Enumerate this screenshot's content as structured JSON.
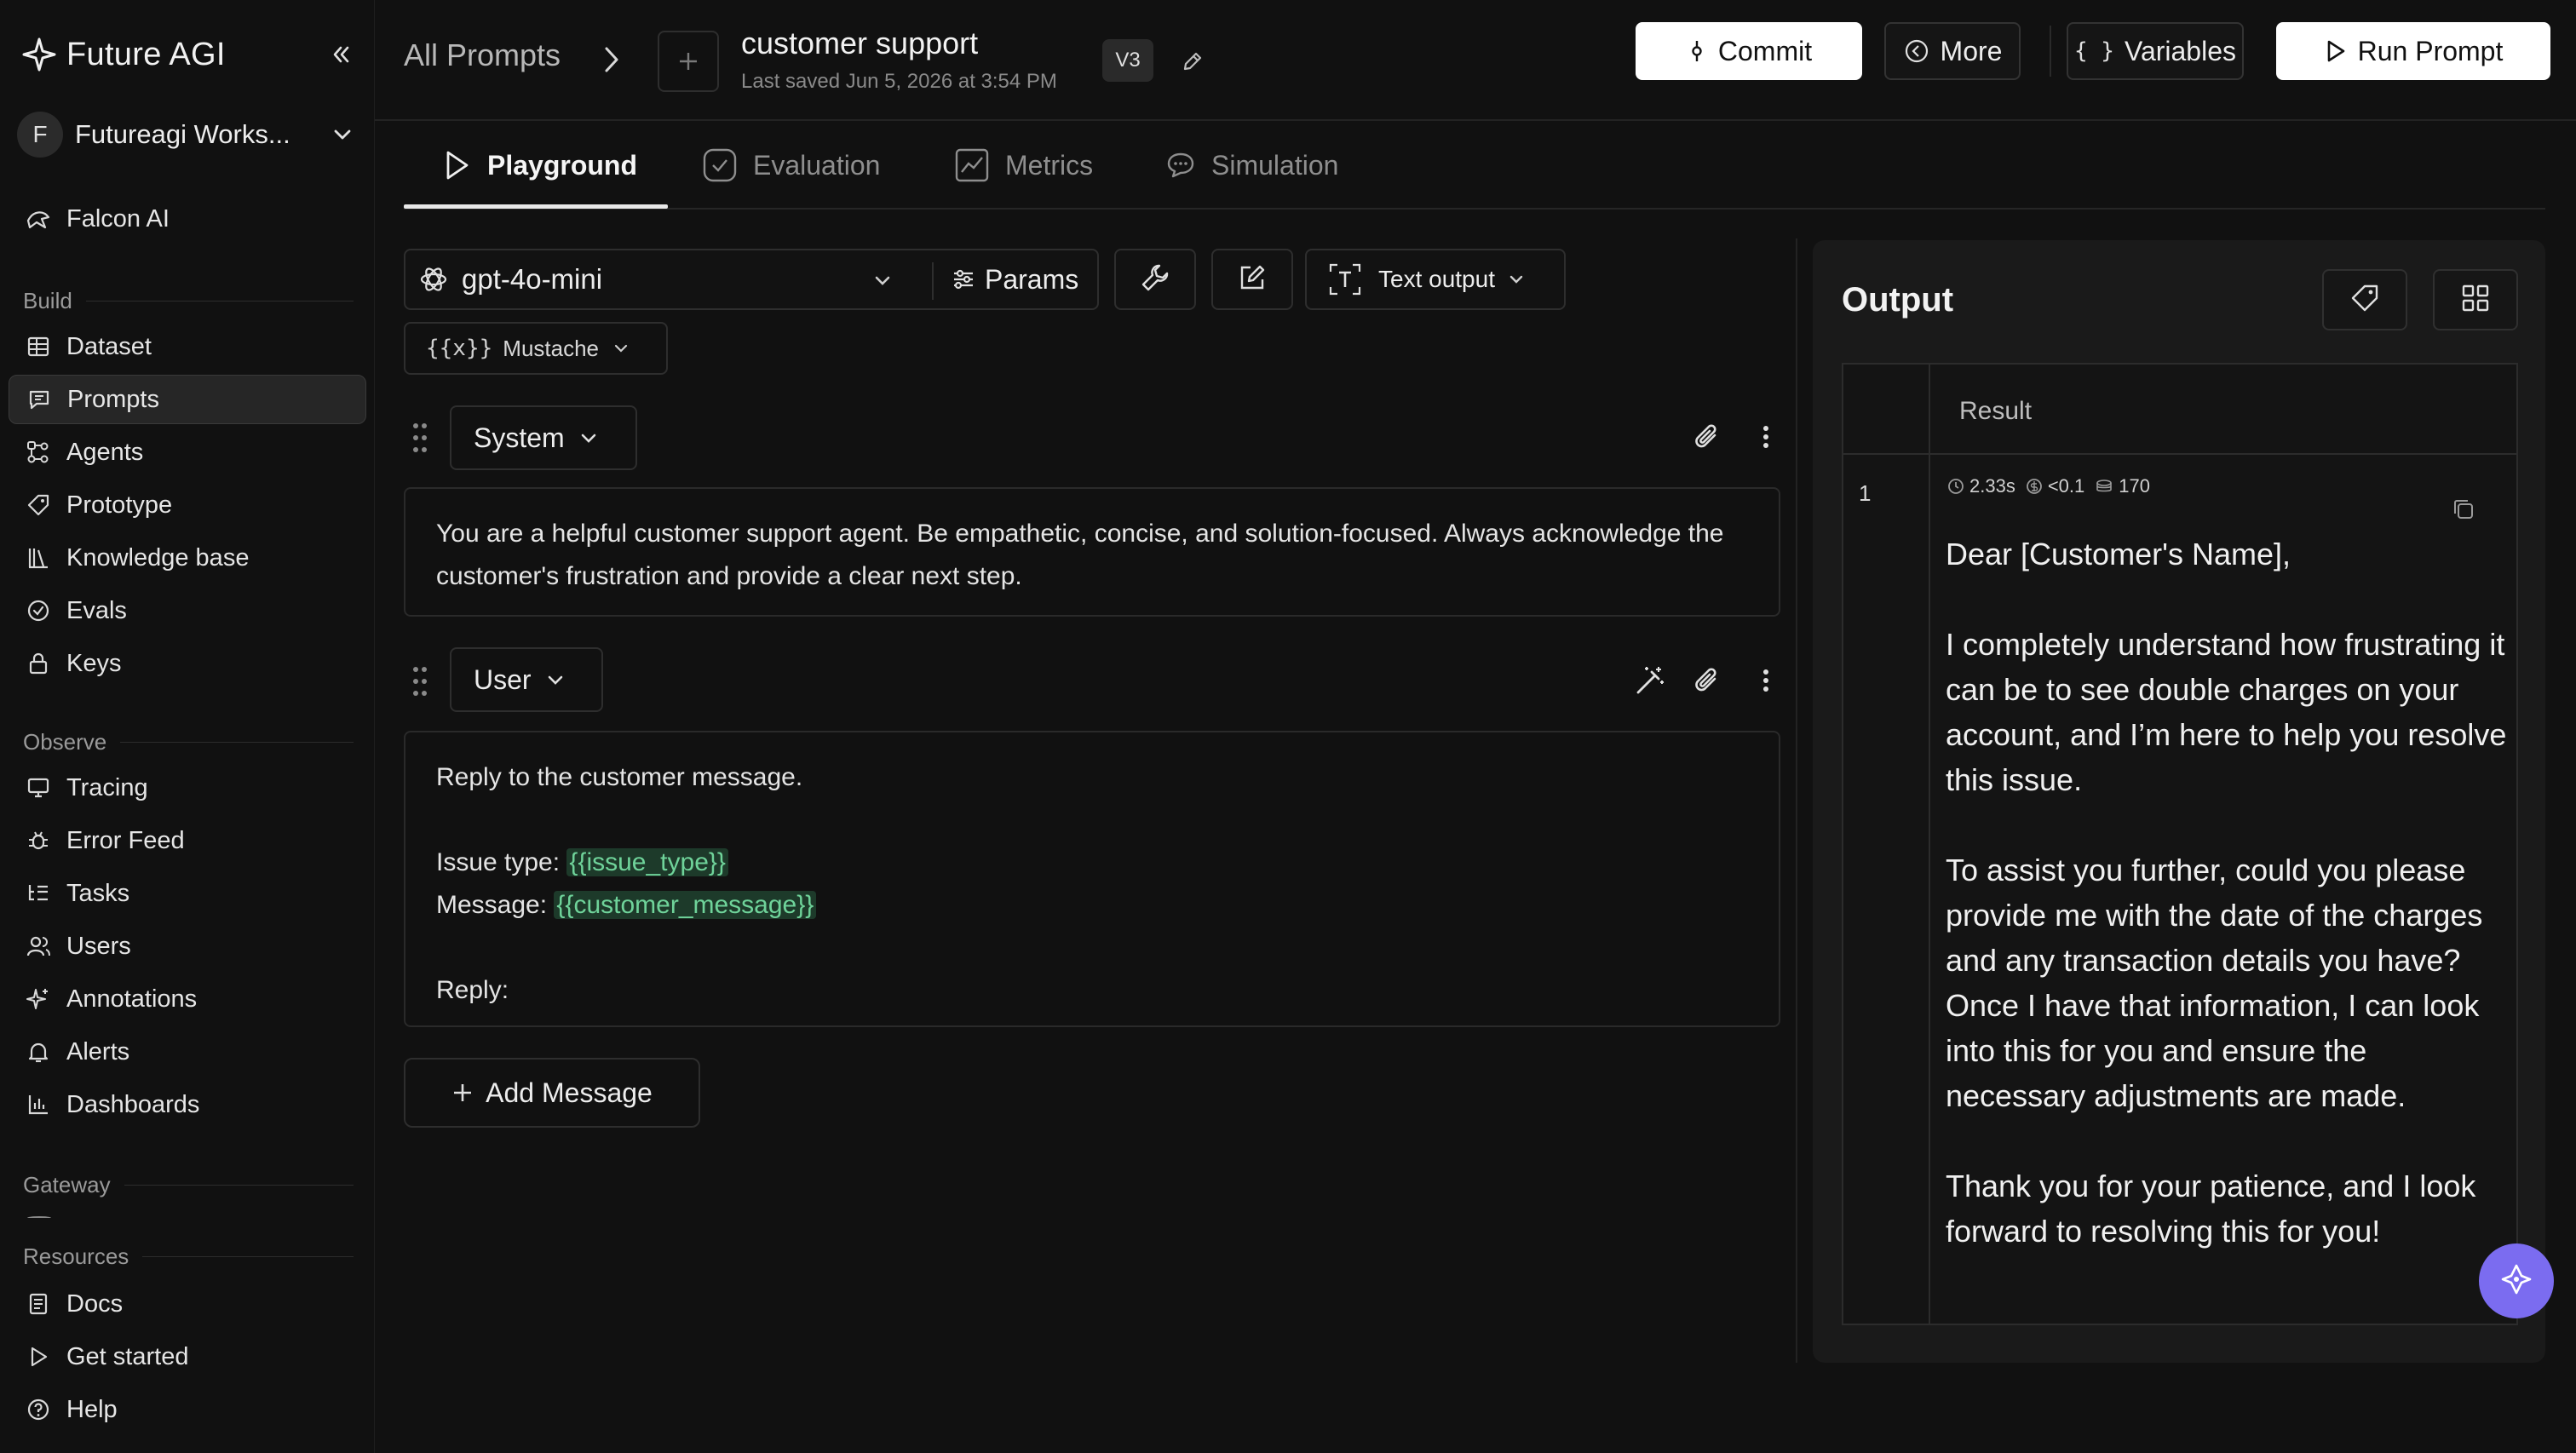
{
  "brand": {
    "name": "Future AGI"
  },
  "workspace": {
    "initial": "F",
    "name": "Futureagi Works..."
  },
  "sidebar": {
    "top_item": {
      "label": "Falcon AI",
      "icon": "falcon-icon"
    },
    "sections": [
      {
        "title": "Build",
        "items": [
          {
            "label": "Dataset",
            "icon": "table-icon"
          },
          {
            "label": "Prompts",
            "icon": "message-icon",
            "active": true
          },
          {
            "label": "Agents",
            "icon": "agents-icon"
          },
          {
            "label": "Prototype",
            "icon": "tag-icon"
          },
          {
            "label": "Knowledge base",
            "icon": "library-icon"
          },
          {
            "label": "Evals",
            "icon": "check-circle-icon"
          },
          {
            "label": "Keys",
            "icon": "lock-icon"
          }
        ]
      },
      {
        "title": "Observe",
        "items": [
          {
            "label": "Tracing",
            "icon": "monitor-icon"
          },
          {
            "label": "Error Feed",
            "icon": "bug-icon"
          },
          {
            "label": "Tasks",
            "icon": "list-tree-icon"
          },
          {
            "label": "Users",
            "icon": "users-icon"
          },
          {
            "label": "Annotations",
            "icon": "sparkle-icon"
          },
          {
            "label": "Alerts",
            "icon": "bell-icon"
          },
          {
            "label": "Dashboards",
            "icon": "bar-chart-icon"
          }
        ]
      },
      {
        "title": "Gateway",
        "items": []
      },
      {
        "title": "Resources",
        "items": [
          {
            "label": "Docs",
            "icon": "doc-icon"
          },
          {
            "label": "Get started",
            "icon": "play-icon"
          },
          {
            "label": "Help",
            "icon": "help-icon"
          }
        ]
      }
    ]
  },
  "header": {
    "breadcrumb": "All Prompts",
    "prompt_name": "customer support",
    "last_saved": "Last saved Jun 5, 2026 at 3:54 PM",
    "version": "V3",
    "buttons": {
      "commit": "Commit",
      "more": "More",
      "variables": "Variables",
      "run": "Run Prompt"
    }
  },
  "tabs": [
    {
      "label": "Playground",
      "active": true
    },
    {
      "label": "Evaluation"
    },
    {
      "label": "Metrics"
    },
    {
      "label": "Simulation"
    }
  ],
  "editor": {
    "model": "gpt-4o-mini",
    "params_label": "Params",
    "output_format": "Text output",
    "template_format": {
      "braces": "{{x}}",
      "label": "Mustache"
    },
    "messages": [
      {
        "role": "System",
        "text": "You are a helpful customer support agent. Be empathetic, concise, and solution-focused. Always acknowledge the customer's frustration and provide a clear next step."
      },
      {
        "role": "User",
        "lines": {
          "intro": "Reply to the customer message.",
          "issue_label": "Issue type: ",
          "issue_var": "{{issue_type}}",
          "message_label": "Message: ",
          "message_var": "{{customer_message}}",
          "reply": "Reply:"
        }
      }
    ],
    "add_message": "Add Message"
  },
  "output": {
    "title": "Output",
    "column_header": "Result",
    "rows": [
      {
        "index": "1",
        "latency": "2.33s",
        "cost": "<0.1",
        "tokens": "170",
        "paragraphs": [
          "Dear [Customer's Name],",
          "I completely understand how frustrating it can be to see double charges on your account, and I’m here to help you resolve this issue.",
          "To assist you further, could you please provide me with the date of the charges and any transaction details you have? Once I have that information, I can look into this for you and ensure the necessary adjustments are made.",
          "Thank you for your patience, and I look forward to resolving this for you!"
        ]
      }
    ]
  },
  "colors": {
    "background": "#111111",
    "panel": "#1a1a1a",
    "accent": "#7b6cf0",
    "variable_text": "#6fd39a",
    "variable_bg": "#1d3a2a"
  }
}
